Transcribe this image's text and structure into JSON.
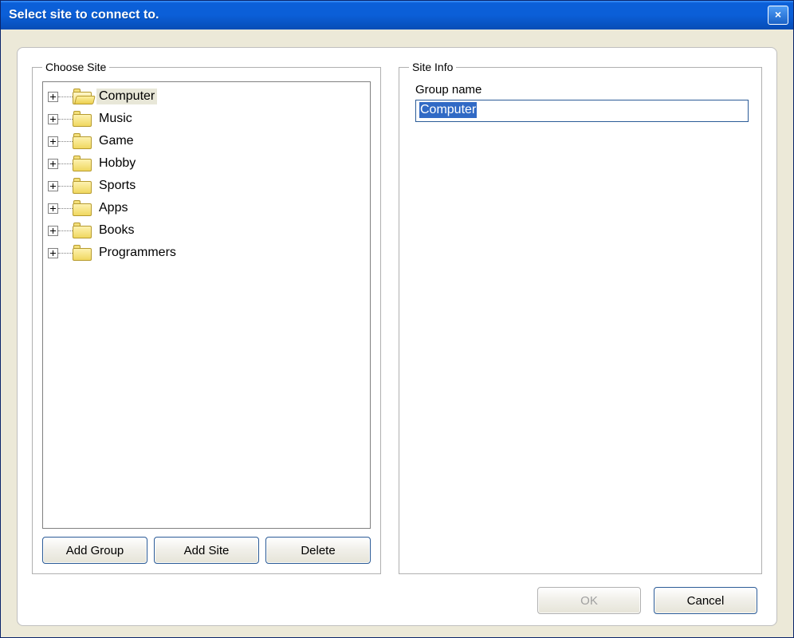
{
  "window": {
    "title": "Select site to connect to."
  },
  "choose_site": {
    "legend": "Choose Site",
    "items": [
      {
        "label": "Computer",
        "selected": true,
        "open": true
      },
      {
        "label": "Music",
        "selected": false,
        "open": false
      },
      {
        "label": "Game",
        "selected": false,
        "open": false
      },
      {
        "label": "Hobby",
        "selected": false,
        "open": false
      },
      {
        "label": "Sports",
        "selected": false,
        "open": false
      },
      {
        "label": "Apps",
        "selected": false,
        "open": false
      },
      {
        "label": "Books",
        "selected": false,
        "open": false
      },
      {
        "label": "Programmers",
        "selected": false,
        "open": false
      }
    ],
    "buttons": {
      "add_group": "Add Group",
      "add_site": "Add Site",
      "delete": "Delete"
    }
  },
  "site_info": {
    "legend": "Site Info",
    "group_name_label": "Group name",
    "group_name_value": "Computer"
  },
  "footer": {
    "ok": "OK",
    "cancel": "Cancel",
    "ok_enabled": false
  }
}
